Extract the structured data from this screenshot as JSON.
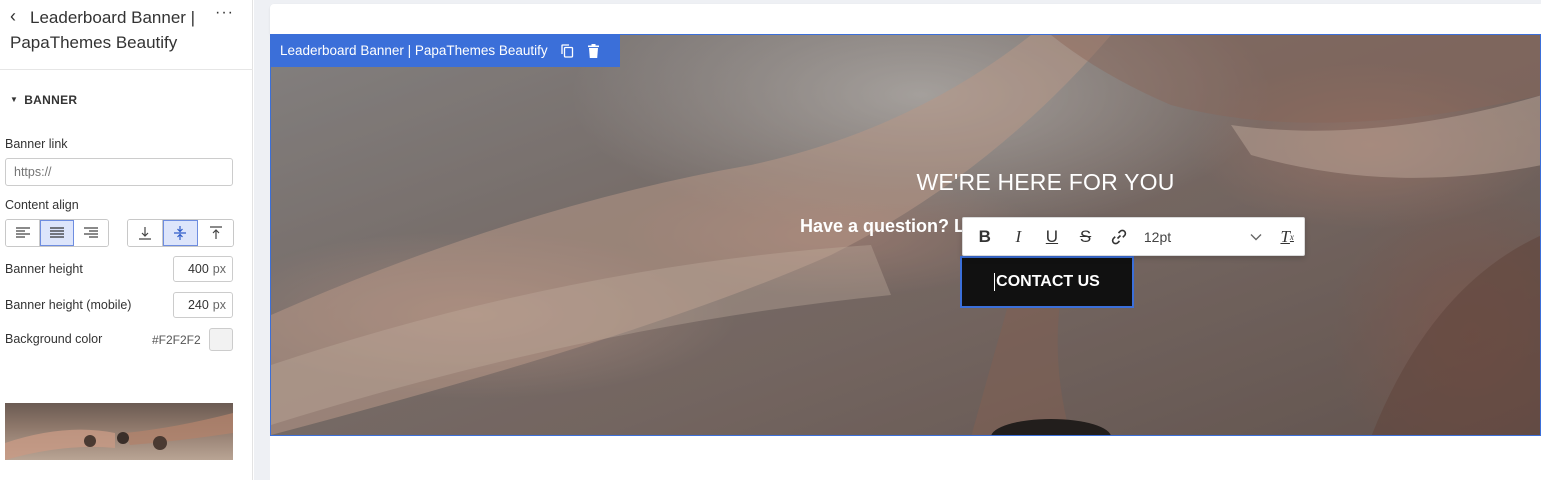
{
  "sidebar": {
    "title": "Leaderboard Banner | PapaThemes Beautify",
    "section": "BANNER",
    "banner_link": {
      "label": "Banner link",
      "placeholder": "https://"
    },
    "content_align": {
      "label": "Content align"
    },
    "banner_height": {
      "label": "Banner height",
      "value": "400",
      "unit": "px"
    },
    "banner_height_mobile": {
      "label": "Banner height (mobile)",
      "value": "240",
      "unit": "px"
    },
    "background_color": {
      "label": "Background color",
      "value": "#F2F2F2"
    }
  },
  "canvas": {
    "banner_tag": "Leaderboard Banner | PapaThemes Beautify",
    "heading": "WE'RE HERE FOR YOU",
    "subheading": "Have a question? Le",
    "button": "CONTACT US",
    "toolbar": {
      "font_size": "12pt"
    }
  }
}
